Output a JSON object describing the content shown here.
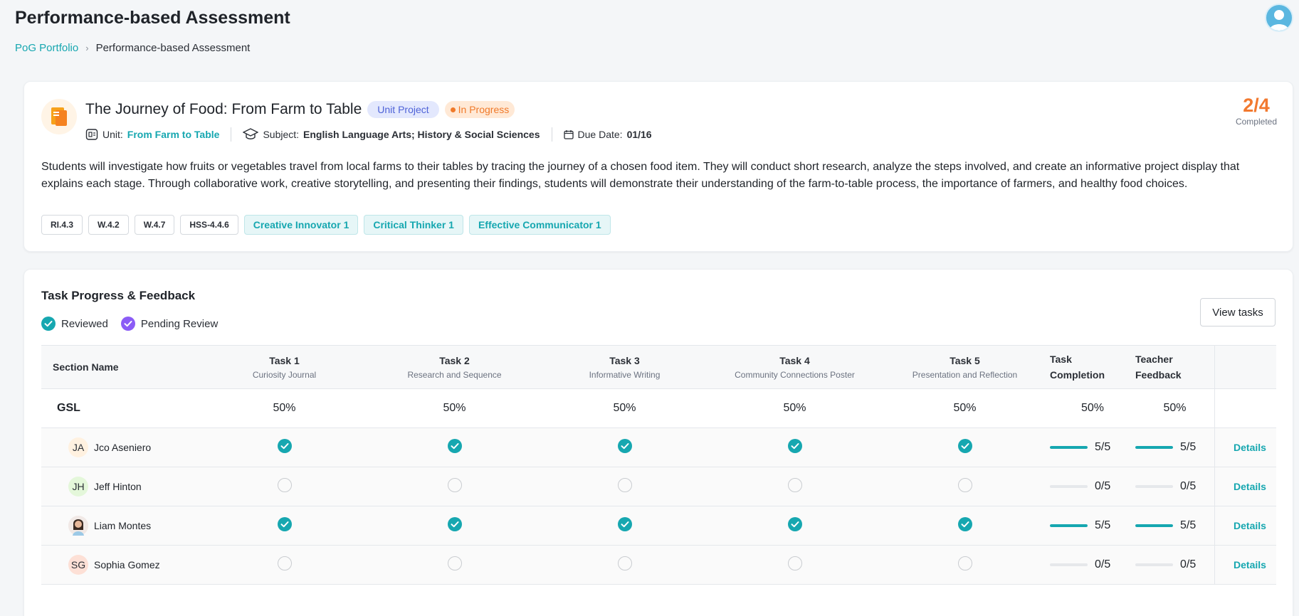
{
  "header": {
    "title": "Performance‑based Assessment",
    "breadcrumb": {
      "parent": "PoG Portfolio",
      "current": "Performance-based Assessment"
    }
  },
  "project": {
    "title": "The Journey of Food: From Farm to Table",
    "type_badge": "Unit Project",
    "status_badge": "In Progress",
    "unit_label": "Unit:",
    "unit_value": "From Farm to Table",
    "subject_label": "Subject:",
    "subject_value": "English Language Arts; History & Social Sciences",
    "due_label": "Due Date:",
    "due_value": "01/16",
    "completed_count": "2/4",
    "completed_label": "Completed",
    "description": "Students will investigate how fruits or vegetables travel from local farms to their tables by tracing the journey of a chosen food item. They will conduct short research, analyze the steps involved, and create an informative project display that explains each stage. Through collaborative work, creative storytelling, and presenting their findings, students will demonstrate their understanding of the farm‑to‑table process, the importance of farmers, and healthy food choices.",
    "standards": [
      "RI.4.3",
      "W.4.2",
      "W.4.7",
      "HSS‑4.4.6"
    ],
    "pog_tags": [
      "Creative Innovator 1",
      "Critical Thinker 1",
      "Effective Communicator 1"
    ]
  },
  "task_progress": {
    "title": "Task Progress & Feedback",
    "legend": {
      "reviewed": "Reviewed",
      "pending": "Pending Review"
    },
    "view_tasks_label": "View tasks",
    "columns": {
      "section": "Section Name",
      "tasks": [
        {
          "name": "Task 1",
          "sub": "Curiosity Journal"
        },
        {
          "name": "Task 2",
          "sub": "Research and Sequence"
        },
        {
          "name": "Task 3",
          "sub": "Informative Writing"
        },
        {
          "name": "Task 4",
          "sub": "Community Connections Poster"
        },
        {
          "name": "Task 5",
          "sub": "Presentation and Reflection"
        }
      ],
      "completion_1": "Task",
      "completion_2": "Completion",
      "feedback_1": "Teacher",
      "feedback_2": "Feedback"
    },
    "gsl": {
      "name": "GSL",
      "t1": "50%",
      "t2": "50%",
      "t3": "50%",
      "t4": "50%",
      "t5": "50%",
      "completion": "50%",
      "feedback": "50%"
    },
    "details_label": "Details",
    "students": [
      {
        "initials": "JA",
        "name": "Jco Aseniero",
        "done": true,
        "completion": "5/5",
        "feedback": "5/5",
        "avatar_bg": "#fff1e0"
      },
      {
        "initials": "JH",
        "name": "Jeff Hinton",
        "done": false,
        "completion": "0/5",
        "feedback": "0/5",
        "avatar_bg": "#e4f7da"
      },
      {
        "initials": "",
        "name": "Liam Montes",
        "done": true,
        "completion": "5/5",
        "feedback": "5/5",
        "avatar_bg": "#f1e9e6"
      },
      {
        "initials": "SG",
        "name": "Sophia Gomez",
        "done": false,
        "completion": "0/5",
        "feedback": "0/5",
        "avatar_bg": "#fde0d6"
      }
    ]
  },
  "colors": {
    "accent": "#16a7b0",
    "orange": "#f2792f",
    "purple": "#8b5cf6"
  }
}
